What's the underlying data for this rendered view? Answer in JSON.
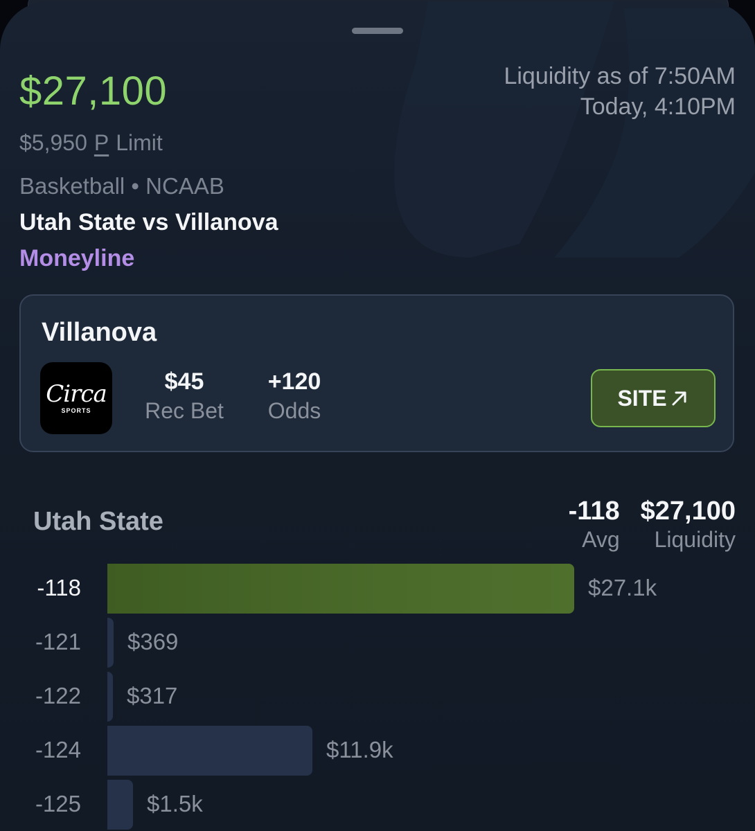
{
  "header": {
    "liquidity_amount": "$27,100",
    "liquidity_as_of": "Liquidity as of 7:50AM",
    "event_time": "Today, 4:10PM",
    "limit_amount": "$5,950",
    "limit_badge": "P",
    "limit_label": "Limit",
    "sport_league": "Basketball • NCAAB",
    "matchup": "Utah State vs Villanova",
    "market": "Moneyline"
  },
  "bet_card": {
    "team": "Villanova",
    "book_logo_text": "Circa",
    "book_logo_subtext": "SPORTS",
    "book_logo_icon": "circa-sports-logo-icon",
    "rec_bet_value": "$45",
    "rec_bet_label": "Rec Bet",
    "odds_value": "+120",
    "odds_label": "Odds",
    "site_button_label": "SITE",
    "site_button_icon": "arrow-up-right-icon"
  },
  "ladder": {
    "team": "Utah State",
    "avg_value": "-118",
    "avg_label": "Avg",
    "liquidity_value": "$27,100",
    "liquidity_label": "Liquidity",
    "max_amount": 27100,
    "rows": [
      {
        "price": "-118",
        "amount": 27100,
        "label": "$27.1k",
        "best": true
      },
      {
        "price": "-121",
        "amount": 369,
        "label": "$369",
        "best": false
      },
      {
        "price": "-122",
        "amount": 317,
        "label": "$317",
        "best": false
      },
      {
        "price": "-124",
        "amount": 11900,
        "label": "$11.9k",
        "best": false
      },
      {
        "price": "-125",
        "amount": 1500,
        "label": "$1.5k",
        "best": false
      }
    ]
  },
  "colors": {
    "accent_green": "#8ed36c",
    "market_purple": "#b48ee6",
    "button_border": "#78b64e",
    "button_fill": "#3b5229",
    "best_bar": "#4a6a2a",
    "bar": "#26324a"
  }
}
